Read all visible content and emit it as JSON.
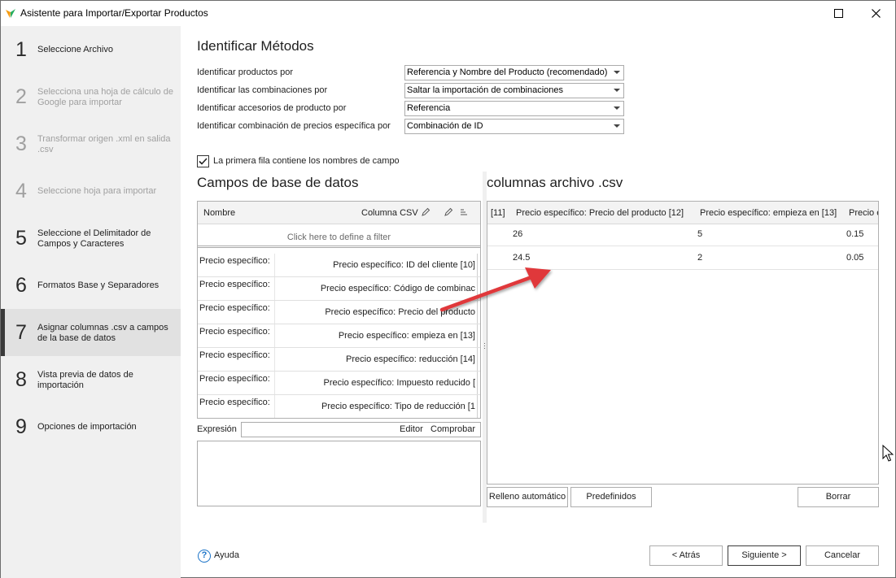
{
  "window": {
    "title": "Asistente para Importar/Exportar Productos"
  },
  "sidebar": {
    "steps": [
      {
        "num": "1",
        "label": "Seleccione Archivo"
      },
      {
        "num": "2",
        "label": "Selecciona una hoja de cálculo de Google para importar"
      },
      {
        "num": "3",
        "label": "Transformar origen .xml en salida .csv"
      },
      {
        "num": "4",
        "label": "Seleccione hoja para importar"
      },
      {
        "num": "5",
        "label": "Seleccione el Delimitador de Campos y Caracteres"
      },
      {
        "num": "6",
        "label": "Formatos Base y Separadores"
      },
      {
        "num": "7",
        "label": "Asignar columnas .csv a campos de la base de datos"
      },
      {
        "num": "8",
        "label": "Vista previa de datos de importación"
      },
      {
        "num": "9",
        "label": "Opciones de importación"
      }
    ],
    "active_step": 7
  },
  "methods": {
    "heading": "Identificar Métodos",
    "rows": [
      {
        "label": "Identificar productos por",
        "value": "Referencia y Nombre del Producto (recomendado)"
      },
      {
        "label": "Identificar las combinaciones por",
        "value": "Saltar la importación de combinaciones"
      },
      {
        "label": "Identificar accesorios de producto por",
        "value": "Referencia"
      },
      {
        "label": "Identificar combinación de precios específica por",
        "value": "Combinación de ID"
      }
    ]
  },
  "first_row_checkbox": {
    "label": "La primera fila contiene los nombres de campo",
    "checked": true
  },
  "db_fields": {
    "heading": "Campos de base de datos",
    "col_name": "Nombre",
    "col_csv": "Columna CSV",
    "filter_hint": "Click here to define a filter",
    "rows": [
      {
        "name": "Precio específico:",
        "csv": "Precio específico: ID del cliente [10]"
      },
      {
        "name": "Precio específico:",
        "csv": "Precio específico: Código de combinac"
      },
      {
        "name": "Precio específico:",
        "csv": "Precio específico: Precio del producto"
      },
      {
        "name": "Precio específico:",
        "csv": "Precio específico: empieza en [13]"
      },
      {
        "name": "Precio específico:",
        "csv": "Precio específico: reducción [14]"
      },
      {
        "name": "Precio específico:",
        "csv": "Precio específico: Impuesto reducido ["
      },
      {
        "name": "Precio específico:",
        "csv": "Precio específico: Tipo de reducción [1"
      }
    ]
  },
  "expression": {
    "label": "Expresión",
    "editor": "Editor",
    "check": "Comprobar"
  },
  "csv_columns": {
    "heading": "columnas archivo .csv",
    "headers": [
      "[11]",
      "Precio específico: Precio del producto [12]",
      "Precio específico: empieza en [13]",
      "Precio e"
    ],
    "rows": [
      [
        "",
        "26",
        "5",
        "0.15"
      ],
      [
        "",
        "24.5",
        "2",
        "0.05"
      ]
    ]
  },
  "buttons": {
    "autofill": "Relleno automático",
    "presets": "Predefinidos",
    "clear": "Borrar",
    "back": "< Atrás",
    "next": "Siguiente >",
    "cancel": "Cancelar",
    "help": "Ayuda"
  },
  "colors": {
    "sidebar_bg": "#f0f0f0",
    "active_step_bg": "#e1e1e1",
    "arrow": "#e0383a",
    "help_blue": "#1a73c8"
  }
}
